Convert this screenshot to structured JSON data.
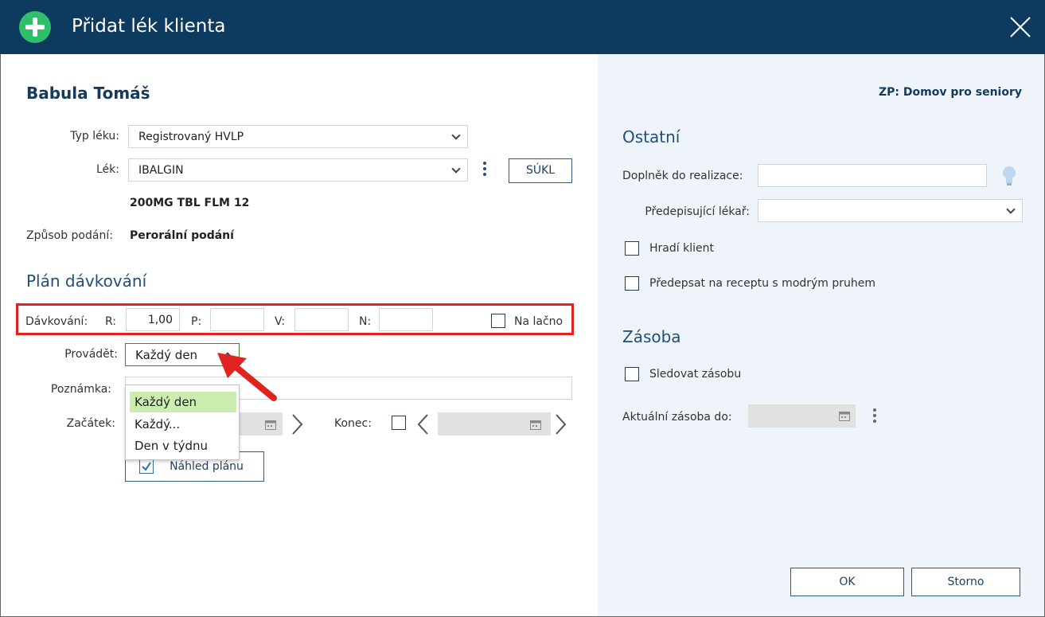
{
  "dialog": {
    "title": "Přidat lék klienta"
  },
  "client": {
    "name": "Babula Tomáš",
    "zp": "ZP: Domov pro seniory"
  },
  "form": {
    "typ_leku_label": "Typ léku:",
    "typ_leku_value": "Registrovaný HVLP",
    "lek_label": "Lék:",
    "lek_value": "IBALGIN",
    "sukl_button": "SÚKL",
    "lek_detail": "200MG TBL FLM 12",
    "zpusob_label": "Způsob podání:",
    "zpusob_value": "Perorální podání"
  },
  "plan": {
    "heading": "Plán dávkování",
    "davkovani_label": "Dávkování:",
    "r_label": "R:",
    "r_value": "1,00",
    "p_label": "P:",
    "p_value": "",
    "v_label": "V:",
    "v_value": "",
    "n_label": "N:",
    "n_value": "",
    "na_lacno_label": "Na lačno",
    "provadet_label": "Provádět:",
    "provadet_value": "Každý den",
    "provadet_options": [
      "Každý den",
      "Každý...",
      "Den v týdnu"
    ],
    "poznamka_label": "Poznámka:",
    "poznamka_value": "",
    "zacatek_label": "Začátek:",
    "konec_label": "Konec:",
    "nahled_button": "Náhled plánu"
  },
  "ostatni": {
    "heading": "Ostatní",
    "doplnek_label": "Doplněk do realizace:",
    "doplnek_value": "",
    "lekar_label": "Předepisující lékař:",
    "lekar_value": "",
    "hradi_label": "Hradí klient",
    "predepsat_label": "Předepsat na receptu s modrým pruhem"
  },
  "zasoba": {
    "heading": "Zásoba",
    "sledovat_label": "Sledovat zásobu",
    "aktualni_label": "Aktuální zásoba do:",
    "aktualni_value": ""
  },
  "footer": {
    "ok_label": "OK",
    "storno_label": "Storno"
  },
  "colors": {
    "titlebar": "#0d3a5f",
    "add_icon": "#2fbf6b",
    "highlight": "#e0231f",
    "selected_option": "#cbeeb0",
    "right_panel": "#eef4fa"
  },
  "icons": [
    "add-icon",
    "close-icon",
    "chevron-down-icon",
    "kebab-menu-icon",
    "lightbulb-icon",
    "calendar-icon",
    "chevron-left-icon",
    "chevron-right-icon",
    "checkmark-icon",
    "pointer-arrow-icon"
  ]
}
